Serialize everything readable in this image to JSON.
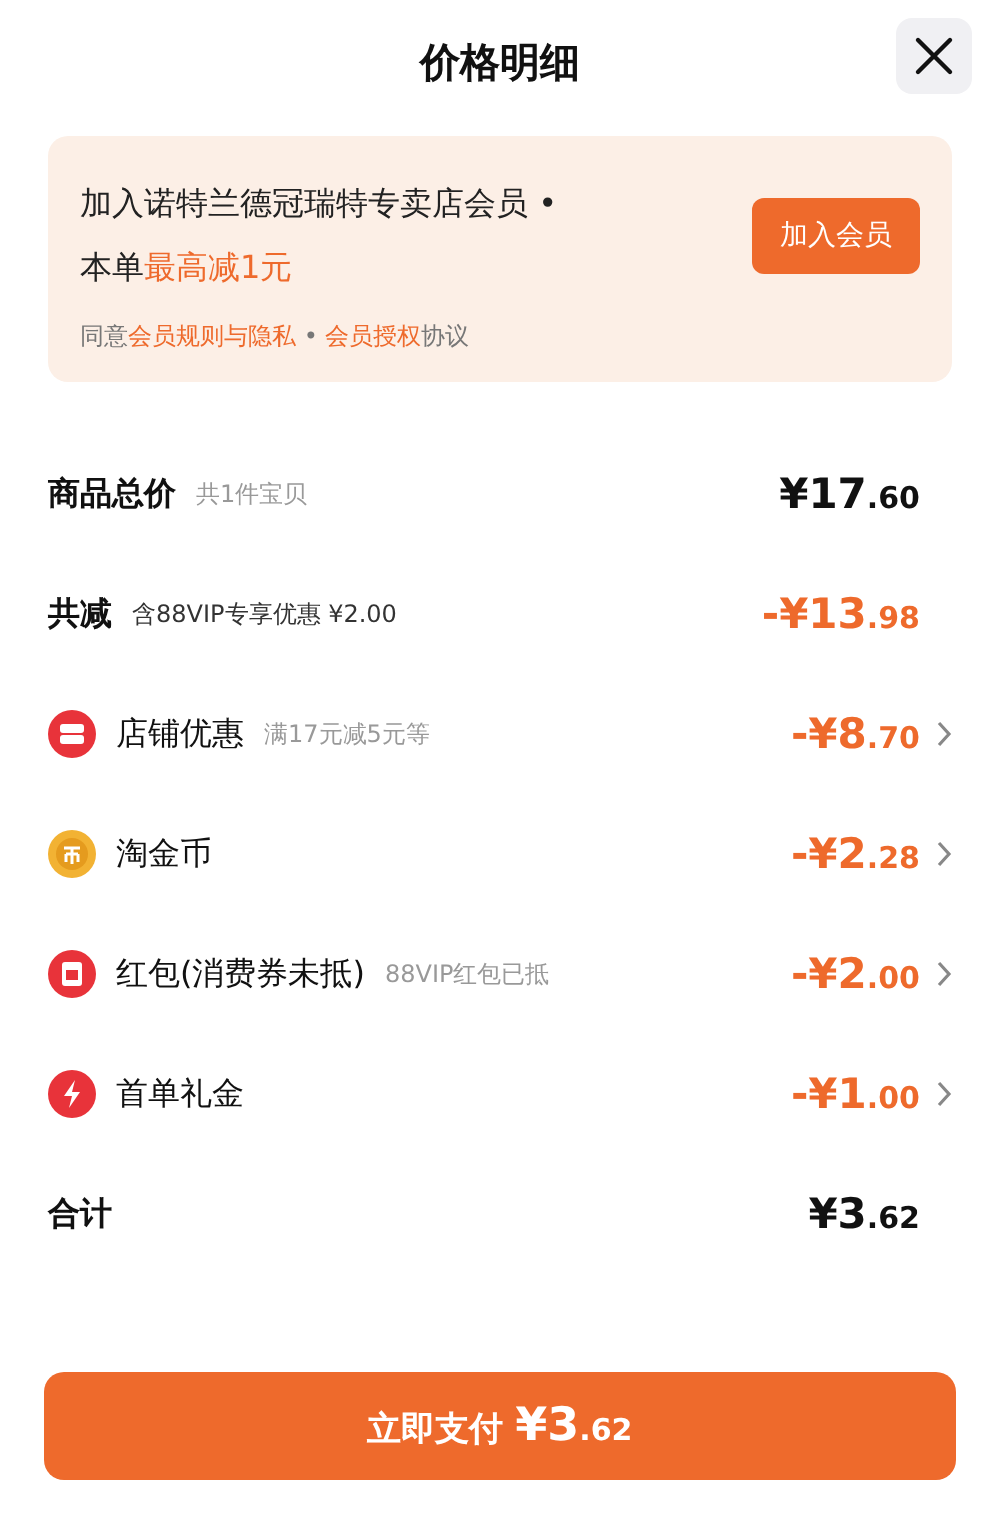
{
  "title": "价格明细",
  "banner": {
    "line1": "加入诺特兰德冠瑞特专卖店会员 •",
    "line2": "本单**最高减1元**",
    "button": "加入会员",
    "agreement": [
      {
        "text": "同意",
        "link": false
      },
      {
        "text": "会员规则与隐私",
        "link": true
      },
      {
        "text": " • ",
        "link": false
      },
      {
        "text": "会员授权",
        "link": true
      },
      {
        "text": "协议",
        "link": false
      }
    ]
  },
  "rows": [
    {
      "kind": "total",
      "label": "商品总价",
      "note": "共1件宝贝",
      "amount": "¥17.60"
    },
    {
      "kind": "saving",
      "label": "共减",
      "note": "含88VIP专享优惠 ¥2.00",
      "amount": "-¥13.98"
    },
    {
      "kind": "shop",
      "label": "店铺优惠",
      "note": "满17元减5元等",
      "amount": "-¥8.70"
    },
    {
      "kind": "coin",
      "label": "淘金币",
      "amount": "-¥2.28"
    },
    {
      "kind": "envelope",
      "label": "红包(消费券未抵)",
      "note": "88VIP红包已抵",
      "amount": "-¥2.00"
    },
    {
      "kind": "bolt",
      "label": "首单礼金",
      "amount": "-¥1.00"
    },
    {
      "kind": "total",
      "label": "合计",
      "amount": "¥3.62"
    }
  ],
  "pay_button": {
    "label": "立即支付",
    "amount": "¥3.62"
  }
}
